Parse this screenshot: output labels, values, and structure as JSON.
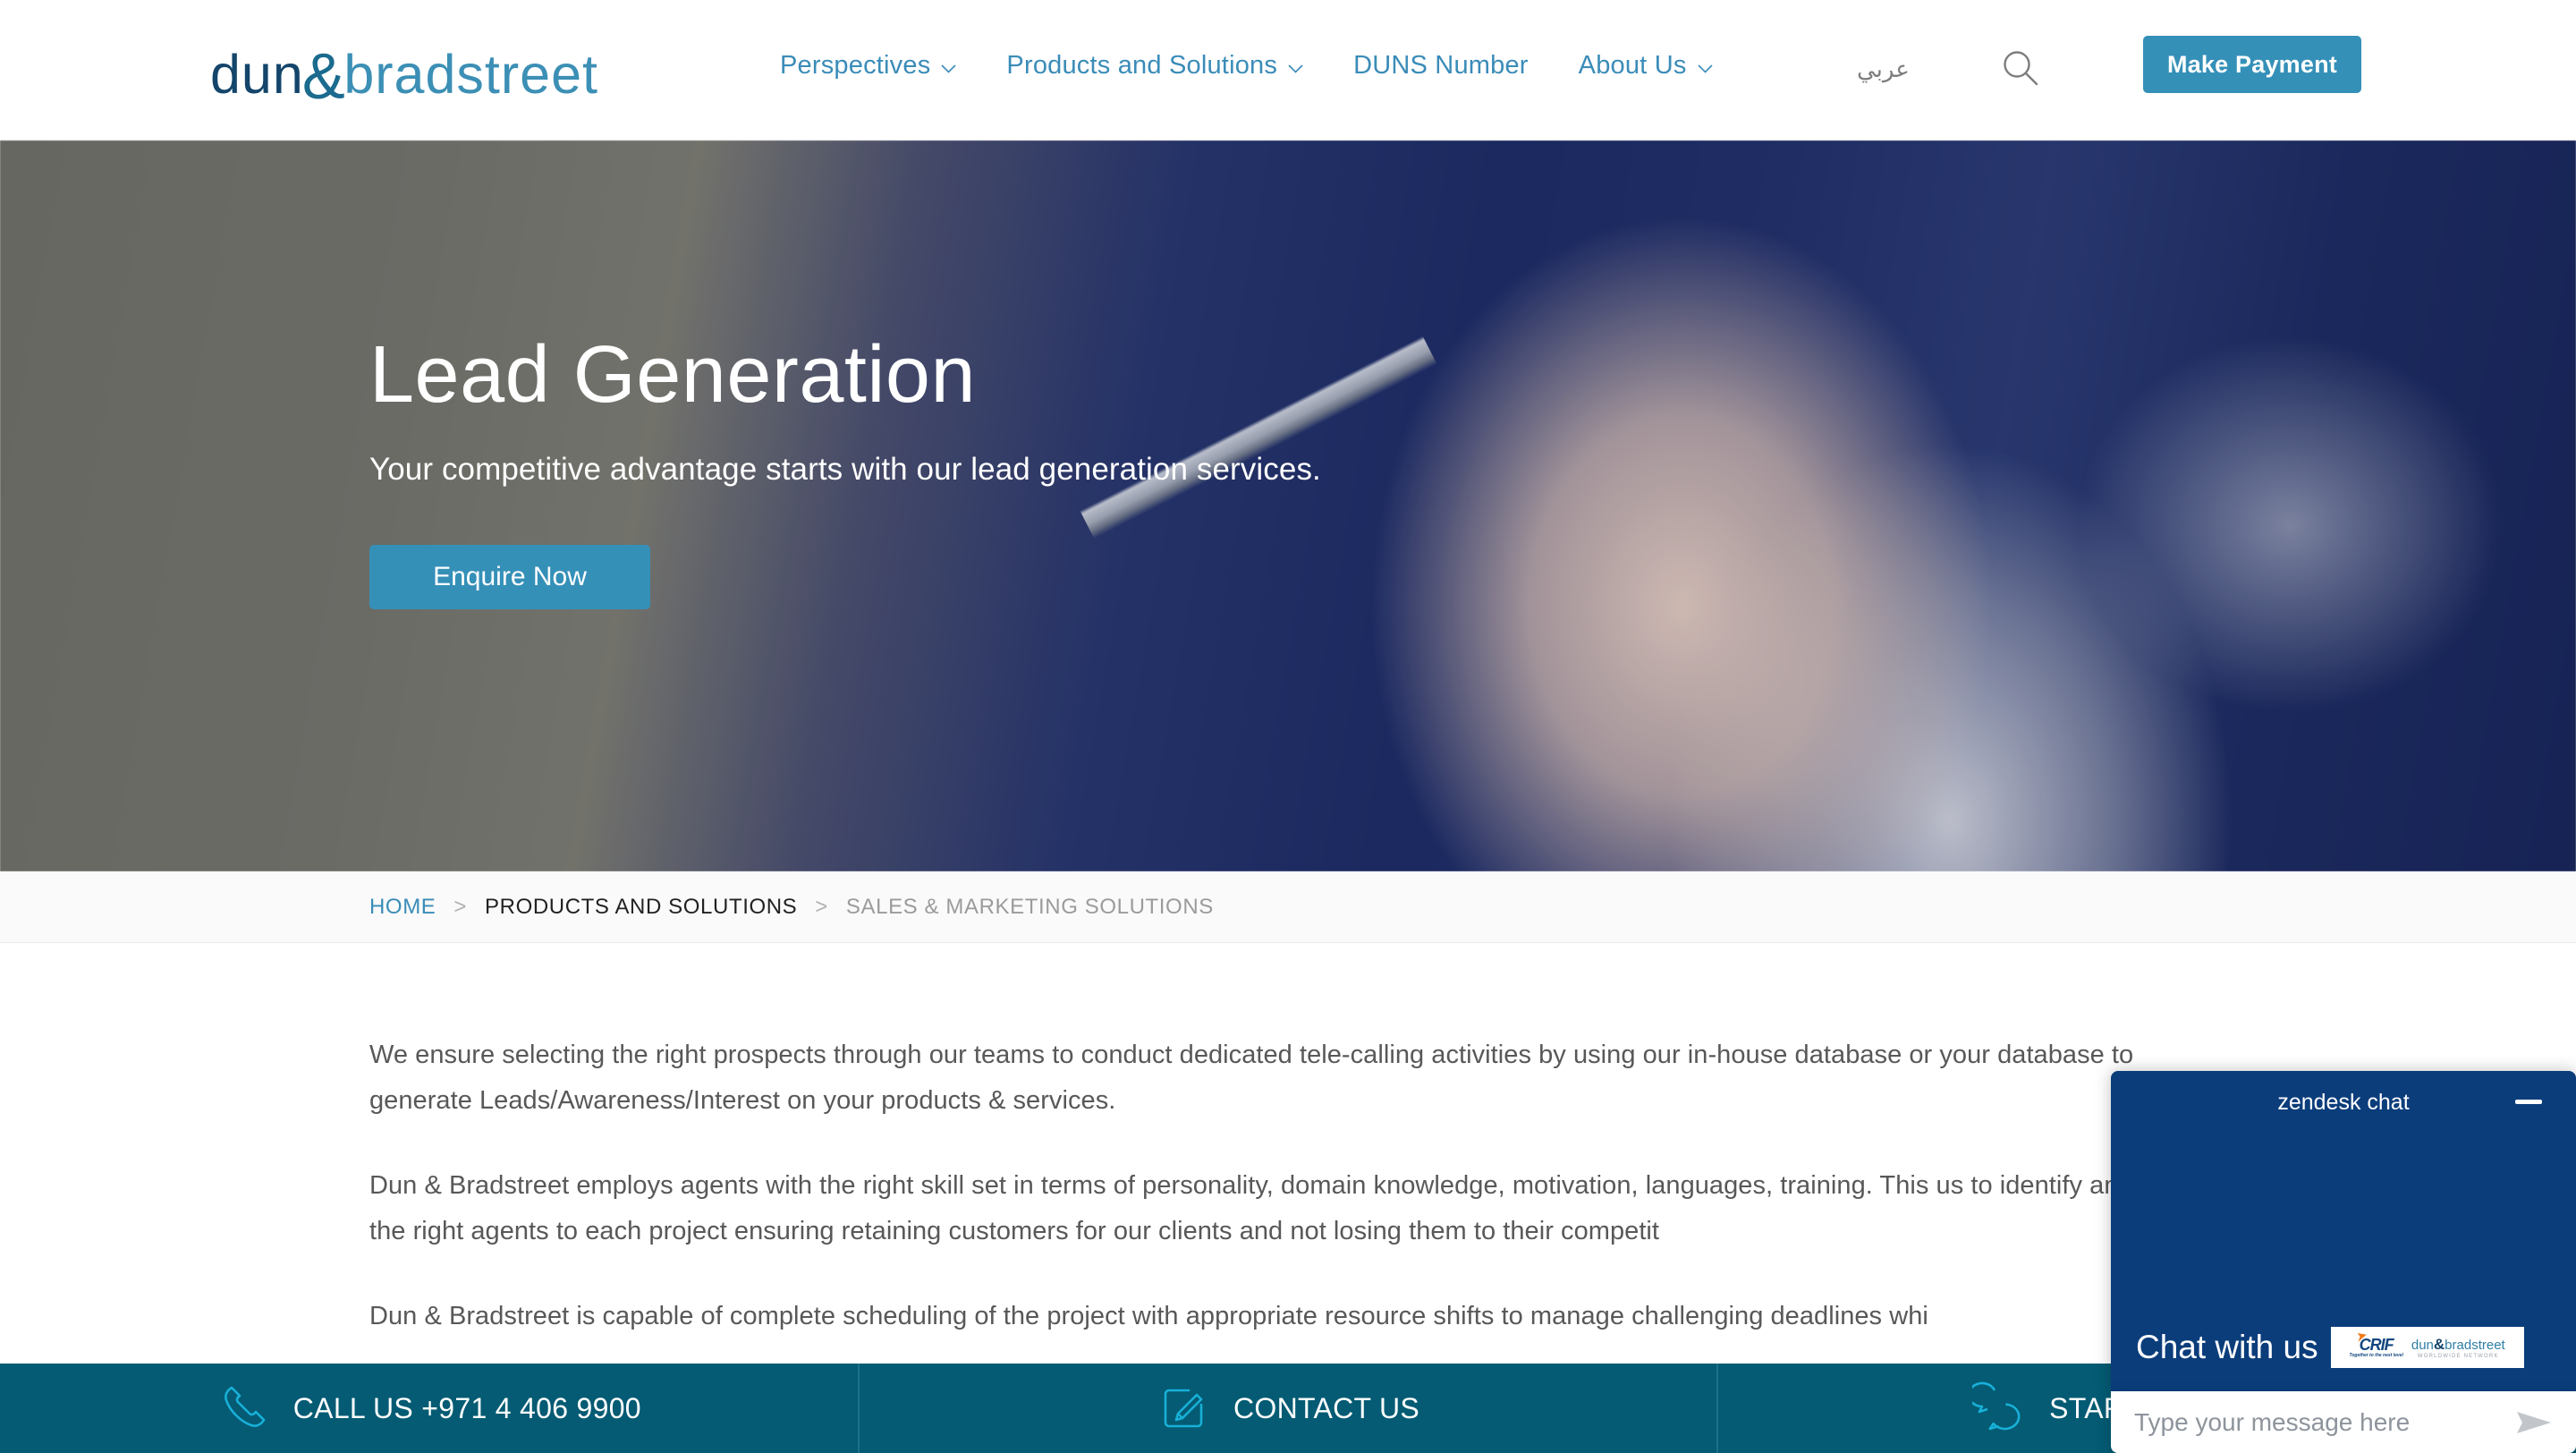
{
  "brand": {
    "logo_part1": "dun",
    "logo_amp": "&",
    "logo_part2": "bradstreet",
    "accent_teal": "#3590b8",
    "accent_navy": "#14456b",
    "bottom_bar_color": "#045b73",
    "chat_panel_color": "#0b3d7b"
  },
  "header": {
    "nav": [
      {
        "label": "Perspectives",
        "has_dropdown": true
      },
      {
        "label": "Products and Solutions",
        "has_dropdown": true
      },
      {
        "label": "DUNS Number",
        "has_dropdown": false
      },
      {
        "label": "About Us",
        "has_dropdown": true
      }
    ],
    "language_label": "عربي",
    "search_icon": "search-icon",
    "payment_button": "Make Payment"
  },
  "hero": {
    "title": "Lead Generation",
    "subtitle": "Your competitive advantage starts with our lead generation services.",
    "cta": "Enquire Now"
  },
  "breadcrumb": {
    "separator": ">",
    "items": [
      {
        "label": "HOME",
        "state": "link"
      },
      {
        "label": "PRODUCTS AND SOLUTIONS",
        "state": "parent"
      },
      {
        "label": "SALES & MARKETING SOLUTIONS",
        "state": "current"
      }
    ]
  },
  "main": {
    "paragraphs": [
      "We ensure selecting the right prospects through our teams to conduct dedicated tele-calling activities by using our in-house database or your database to generate Leads/Awareness/Interest on your products & services.",
      "Dun & Bradstreet employs agents with the right skill set in terms of personality, domain knowledge, motivation, languages, training. This us to identify and map the right agents to each project ensuring retaining customers for our clients and not losing them to their competit",
      "Dun & Bradstreet is capable of complete scheduling of the project with appropriate resource shifts to manage challenging deadlines whi"
    ]
  },
  "bottom_bar": {
    "items": [
      {
        "label": "CALL US +971 4 406 9900",
        "icon": "phone-icon"
      },
      {
        "label": "CONTACT US",
        "icon": "pencil-document-icon"
      },
      {
        "label": "START A LIVE CHAT",
        "icon": "chat-bubbles-icon"
      }
    ]
  },
  "chat_widget": {
    "title": "zendesk chat",
    "minimize_icon": "minimize-icon",
    "greeting": "Chat with us",
    "badge": {
      "crif_name": "CRIF",
      "crif_tagline": "Together to the next level",
      "db_part1": "dun",
      "db_amp": "&",
      "db_part2": "bradstreet",
      "db_tagline": "WORLDWIDE NETWORK"
    },
    "input_placeholder": "Type your message here",
    "input_value": "",
    "send_icon": "send-icon"
  }
}
